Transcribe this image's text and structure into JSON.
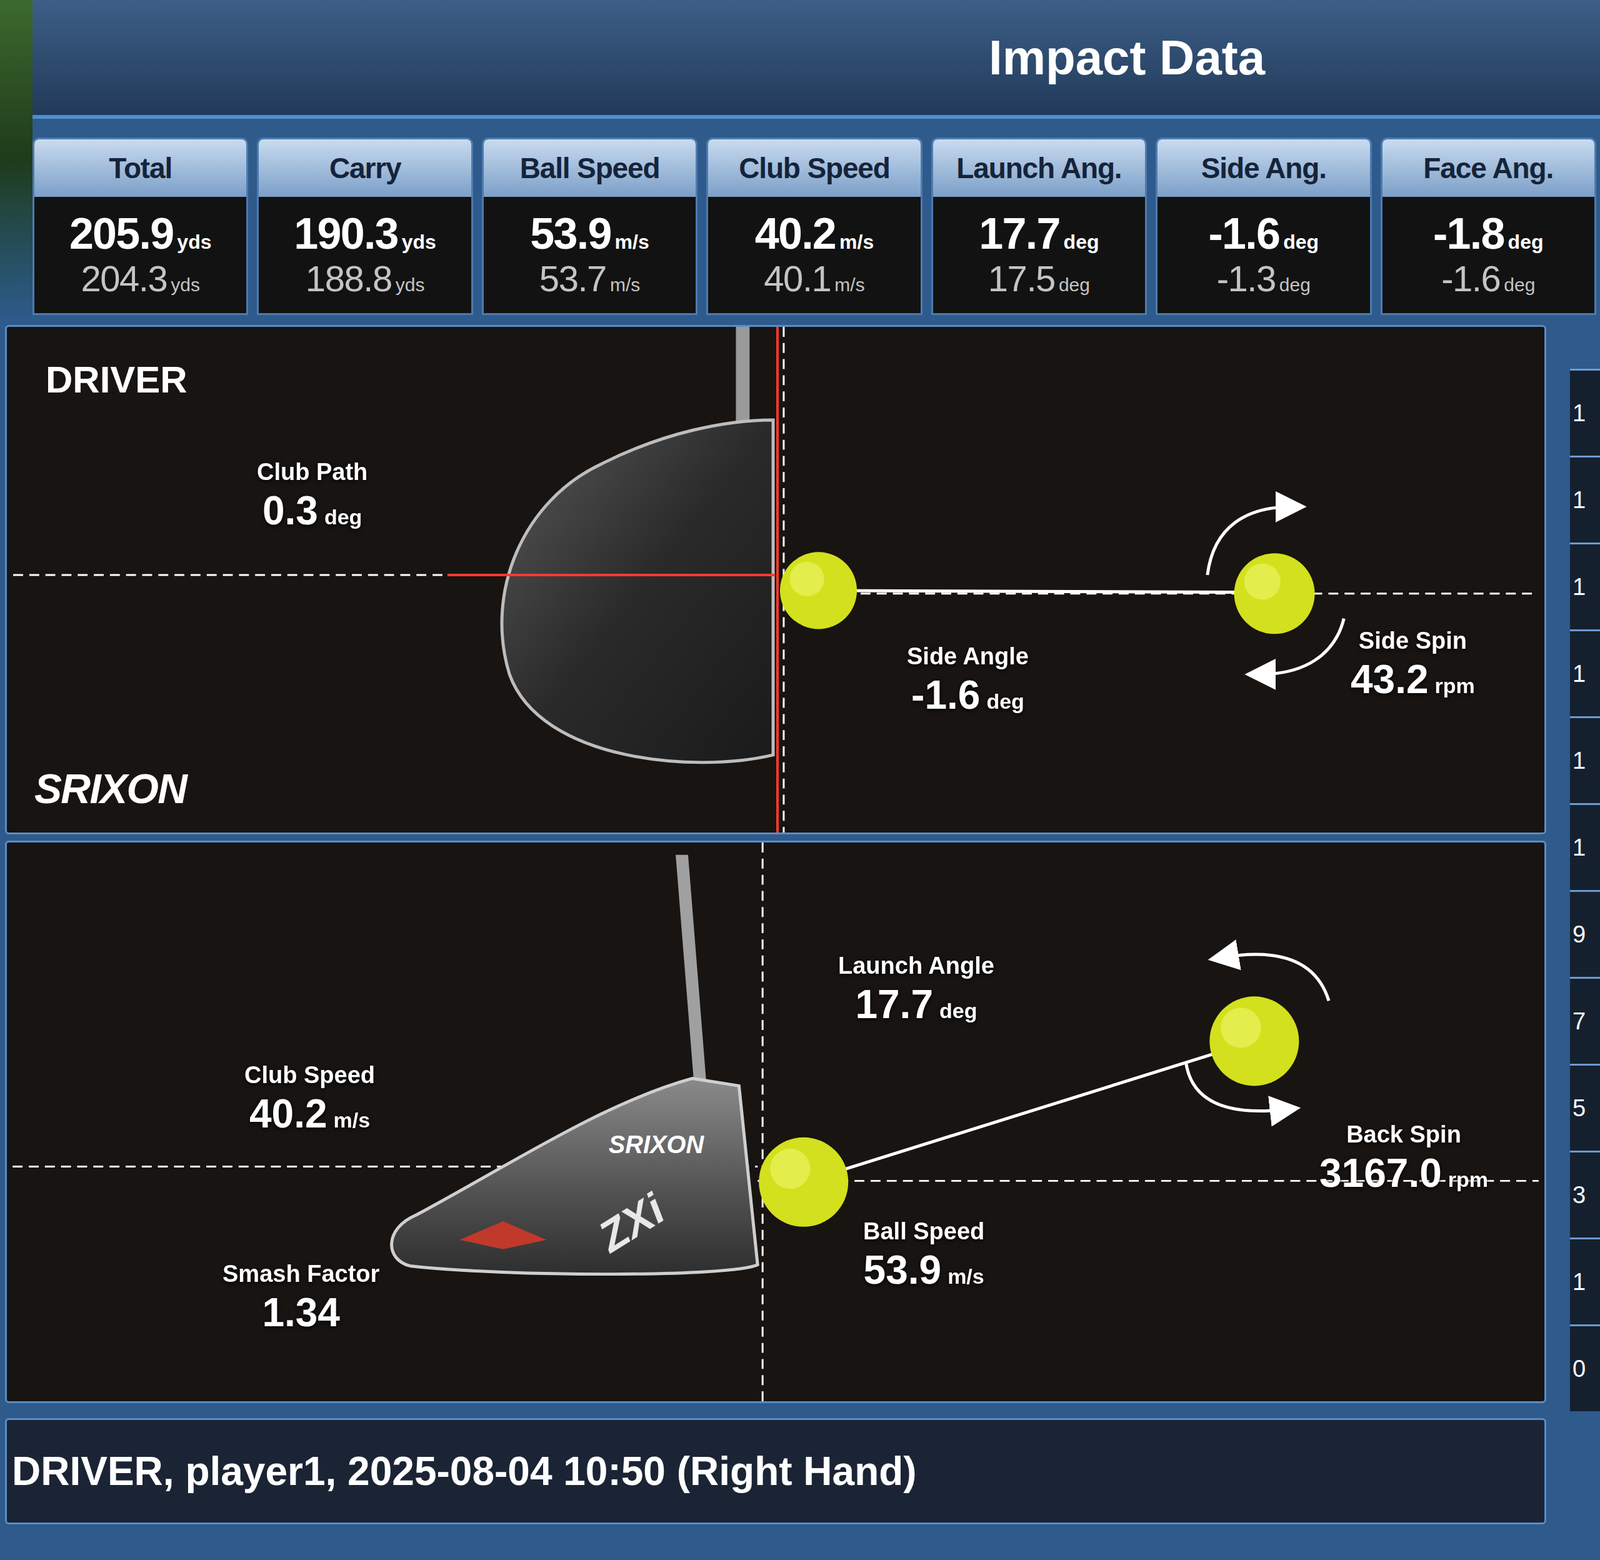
{
  "header": {
    "title": "Impact Data"
  },
  "stats": [
    {
      "label": "Total",
      "value": "205.9",
      "unit": "yds",
      "value2": "204.3",
      "unit2": "yds"
    },
    {
      "label": "Carry",
      "value": "190.3",
      "unit": "yds",
      "value2": "188.8",
      "unit2": "yds"
    },
    {
      "label": "Ball Speed",
      "value": "53.9",
      "unit": "m/s",
      "value2": "53.7",
      "unit2": "m/s"
    },
    {
      "label": "Club Speed",
      "value": "40.2",
      "unit": "m/s",
      "value2": "40.1",
      "unit2": "m/s"
    },
    {
      "label": "Launch Ang.",
      "value": "17.7",
      "unit": "deg",
      "value2": "17.5",
      "unit2": "deg"
    },
    {
      "label": "Side Ang.",
      "value": "-1.6",
      "unit": "deg",
      "value2": "-1.3",
      "unit2": "deg"
    },
    {
      "label": "Face Ang.",
      "value": "-1.8",
      "unit": "deg",
      "value2": "-1.6",
      "unit2": "deg"
    }
  ],
  "top_view": {
    "title": "DRIVER",
    "logo": "SRIXON",
    "club_path": {
      "label": "Club Path",
      "value": "0.3",
      "unit": "deg"
    },
    "side_angle": {
      "label": "Side Angle",
      "value": "-1.6",
      "unit": "deg"
    },
    "side_spin": {
      "label": "Side Spin",
      "value": "43.2",
      "unit": "rpm"
    }
  },
  "side_view": {
    "club_brand": "SRIXON",
    "club_model": "ZXi",
    "club_speed": {
      "label": "Club Speed",
      "value": "40.2",
      "unit": "m/s"
    },
    "smash_factor": {
      "label": "Smash Factor",
      "value": "1.34",
      "unit": ""
    },
    "launch_angle": {
      "label": "Launch Angle",
      "value": "17.7",
      "unit": "deg"
    },
    "back_spin": {
      "label": "Back Spin",
      "value": "3167.0",
      "unit": "rpm"
    },
    "ball_speed": {
      "label": "Ball Speed",
      "value": "53.9",
      "unit": "m/s"
    }
  },
  "right_scale": [
    "1",
    "1",
    "1",
    "1",
    "1",
    "1",
    "9",
    "7",
    "5",
    "3",
    "1",
    "0"
  ],
  "footer": {
    "text": "DRIVER, player1, 2025-08-04 10:50 (Right Hand)"
  }
}
